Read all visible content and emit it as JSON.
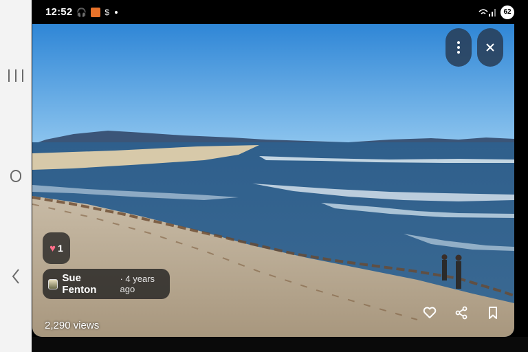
{
  "status_bar": {
    "time": "12:52",
    "battery": "62"
  },
  "photo": {
    "like_count": "1",
    "author": "Sue Fenton",
    "posted": "· 4 years ago",
    "views": "2,290 views"
  },
  "icons": {
    "more": "more-vert-icon",
    "close": "close-icon",
    "like": "heart-outline-icon",
    "share": "share-icon",
    "save": "bookmark-icon"
  },
  "colors": {
    "sky": "#3f8fd8",
    "sea": "#2d5c86",
    "sand": "#b9ab95",
    "overlay_button": "#283c55"
  }
}
